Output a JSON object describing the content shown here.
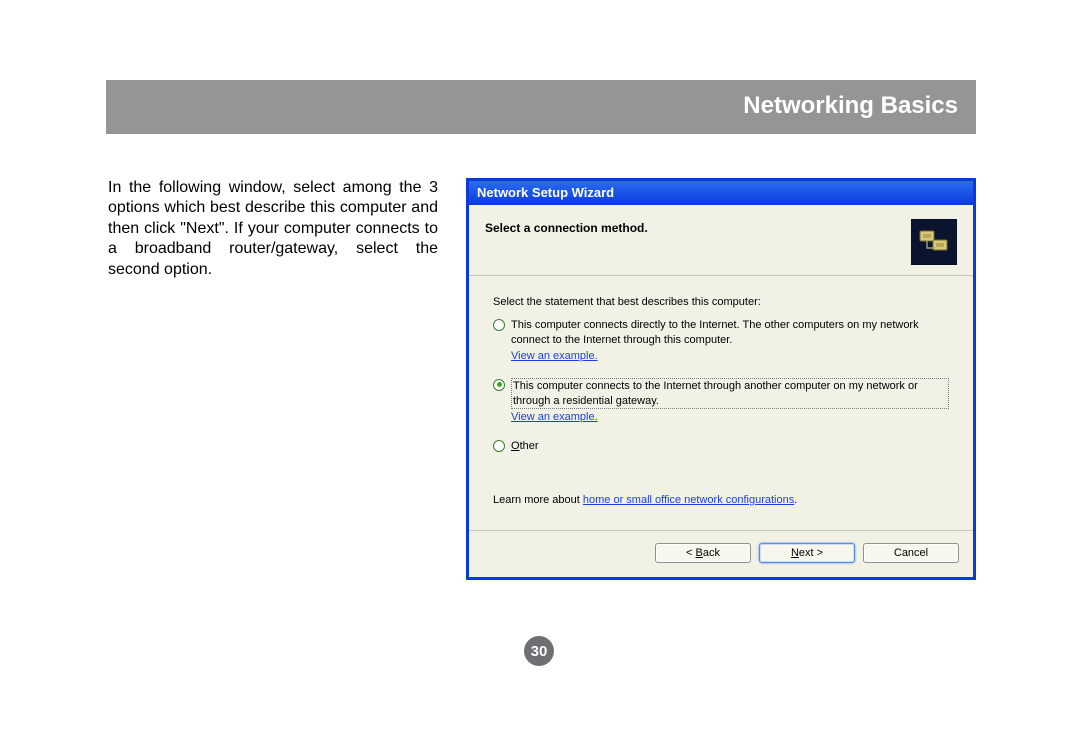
{
  "header": {
    "title": "Networking Basics"
  },
  "instruction": "In the following window, select among the 3 options which best describe this computer and then click \"Next\". If your computer connects to a broadband router/gateway, select the second option.",
  "dialog": {
    "title": "Network Setup Wizard",
    "heading": "Select a connection method.",
    "prompt": "Select the statement that best describes this computer:",
    "options": [
      {
        "text": "This computer connects directly to the Internet. The other computers on my network connect to the Internet through this computer.",
        "example": "View an example.",
        "selected": false
      },
      {
        "text": "This computer connects to the Internet through another computer on my network or through a residential gateway.",
        "example": "View an example.",
        "selected": true
      },
      {
        "text": "Other",
        "example": "",
        "selected": false
      }
    ],
    "learn_prefix": "Learn more about ",
    "learn_link": "home or small office network configurations",
    "learn_suffix": ".",
    "buttons": {
      "back": "< Back",
      "next": "Next >",
      "cancel": "Cancel"
    }
  },
  "page_number": "30"
}
